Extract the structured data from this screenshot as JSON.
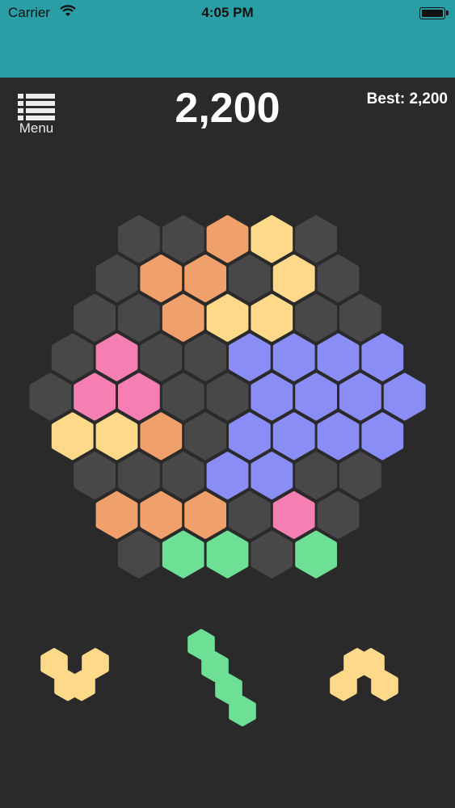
{
  "status_bar": {
    "carrier": "Carrier",
    "time": "4:05 PM",
    "wifi_icon": "wifi-icon",
    "battery_icon": "battery-icon"
  },
  "header": {
    "menu_label": "Menu",
    "menu_icon": "list-menu-icon",
    "score": "2,200",
    "best": "Best: 2,200"
  },
  "colors": {
    "background": "#2a2a2a",
    "status_bar": "#2a9ea5",
    "empty_cell": "#484848",
    "orange": "#f0a06a",
    "yellow": "#ffd98a",
    "blue": "#8a8df6",
    "pink": "#f57fb3",
    "green": "#6ee096"
  },
  "board": {
    "rows": [
      [
        "empty",
        "empty",
        "orange",
        "yellow",
        "empty"
      ],
      [
        "empty",
        "orange",
        "orange",
        "empty",
        "yellow",
        "empty"
      ],
      [
        "empty",
        "empty",
        "orange",
        "yellow",
        "yellow",
        "empty",
        "empty"
      ],
      [
        "empty",
        "pink",
        "empty",
        "empty",
        "blue",
        "blue",
        "blue",
        "blue"
      ],
      [
        "empty",
        "pink",
        "pink",
        "empty",
        "empty",
        "blue",
        "blue",
        "blue",
        "blue"
      ],
      [
        "yellow",
        "yellow",
        "orange",
        "empty",
        "blue",
        "blue",
        "blue",
        "blue"
      ],
      [
        "empty",
        "empty",
        "empty",
        "blue",
        "blue",
        "empty",
        "empty"
      ],
      [
        "orange",
        "orange",
        "orange",
        "empty",
        "pink",
        "empty"
      ],
      [
        "empty",
        "green",
        "green",
        "empty",
        "green"
      ]
    ]
  },
  "pieces": [
    {
      "name": "piece-yellow-w",
      "color": "yellow",
      "cells": [
        [
          0,
          0
        ],
        [
          1,
          1
        ],
        [
          2,
          1
        ],
        [
          3,
          0
        ]
      ]
    },
    {
      "name": "piece-green-diagonal",
      "color": "green",
      "cells": [
        [
          3,
          0
        ],
        [
          2,
          1
        ],
        [
          1,
          2
        ],
        [
          0,
          3
        ]
      ]
    },
    {
      "name": "piece-yellow-arch",
      "color": "yellow",
      "cells": [
        [
          0,
          1
        ],
        [
          1,
          0
        ],
        [
          2,
          0
        ],
        [
          3,
          1
        ]
      ]
    }
  ]
}
